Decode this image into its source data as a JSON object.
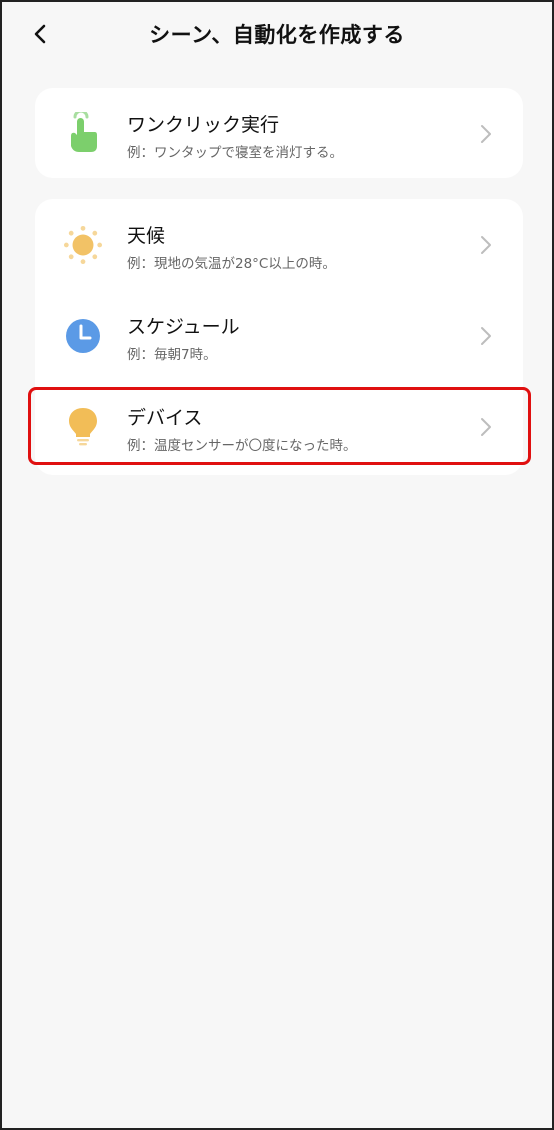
{
  "header": {
    "title": "シーン、自動化を作成する"
  },
  "items": [
    {
      "title": "ワンクリック実行",
      "desc": "例：ワンタップで寝室を消灯する。",
      "icon": "tap-hand-icon"
    },
    {
      "title": "天候",
      "desc": "例：現地の気温が28°C以上の時。",
      "icon": "sun-icon"
    },
    {
      "title": "スケジュール",
      "desc": "例：毎朝7時。",
      "icon": "clock-icon"
    },
    {
      "title": "デバイス",
      "desc": "例：温度センサーが〇度になった時。",
      "icon": "bulb-icon"
    }
  ],
  "colors": {
    "accent_green": "#7ccf6c",
    "sun": "#f2c266",
    "clock": "#5b9ae6",
    "bulb": "#f2bd57",
    "highlight": "#e01010"
  }
}
